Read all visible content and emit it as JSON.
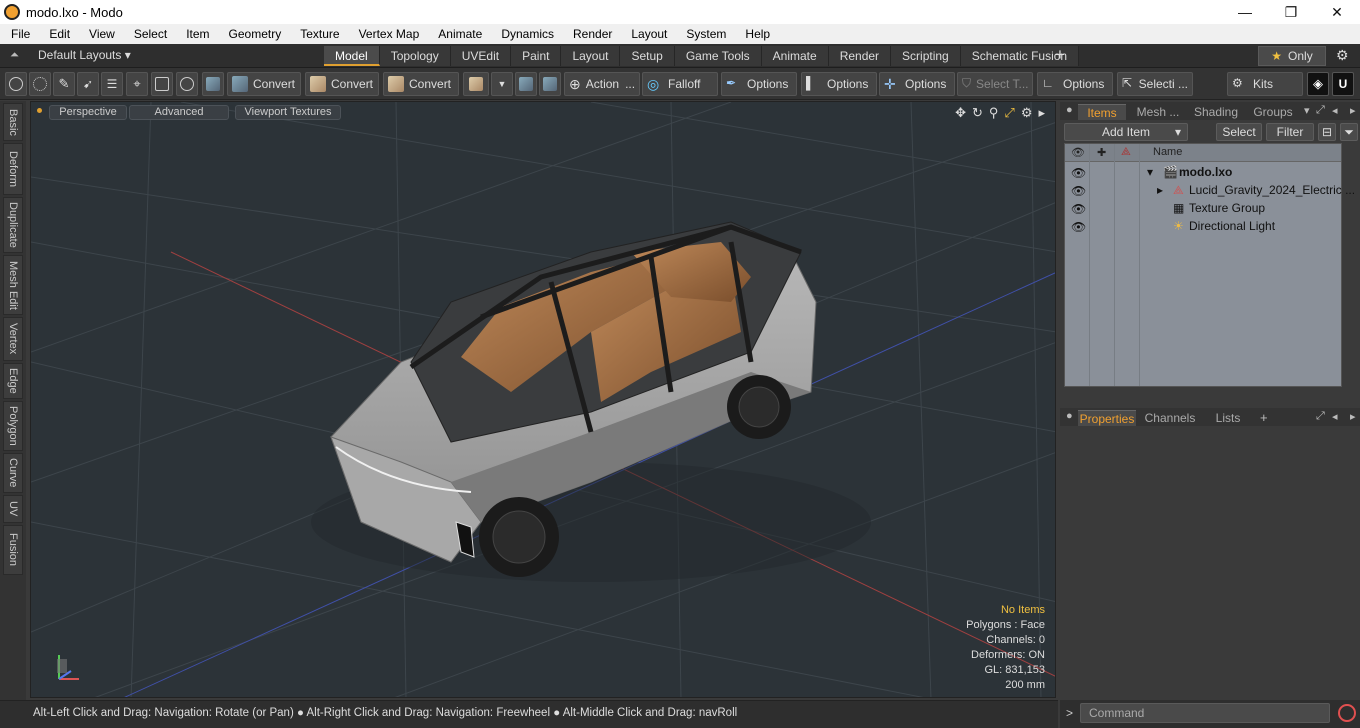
{
  "window": {
    "title": "modo.lxo - Modo",
    "minimize": "—",
    "maximize": "❐",
    "close": "✕"
  },
  "menu": [
    "File",
    "Edit",
    "View",
    "Select",
    "Item",
    "Geometry",
    "Texture",
    "Vertex Map",
    "Animate",
    "Dynamics",
    "Render",
    "Layout",
    "System",
    "Help"
  ],
  "layoutbar": {
    "default_layouts": "Default Layouts ▾",
    "tabs": [
      "Model",
      "Topology",
      "UVEdit",
      "Paint",
      "Layout",
      "Setup",
      "Game Tools",
      "Animate",
      "Render",
      "Scripting",
      "Schematic Fusion"
    ],
    "active_tab": "Model",
    "plus": "+",
    "only": "Only"
  },
  "toolbar": {
    "convert1": "Convert",
    "convert2": "Convert",
    "convert3": "Convert",
    "action": "Action",
    "falloff": "Falloff",
    "options1": "Options",
    "options2": "Options",
    "options3": "Options",
    "select_t": "Select T...",
    "options4": "Options",
    "selecti": "Selecti ...",
    "kits": "Kits"
  },
  "left_tabs": [
    "Basic",
    "Deform",
    "Duplicate",
    "Mesh Edit",
    "Vertex",
    "Edge",
    "Polygon",
    "Curve",
    "UV",
    "Fusion"
  ],
  "viewport": {
    "perspective": "Perspective",
    "advanced": "Advanced",
    "viewport_textures": "Viewport Textures",
    "stats": {
      "no_items": "No Items",
      "polygons": "Polygons : Face",
      "channels": "Channels: 0",
      "deformers": "Deformers: ON",
      "gl": "GL: 831,153",
      "size": "200 mm"
    }
  },
  "statusbar": "Alt-Left Click and Drag: Navigation: Rotate (or Pan) ● Alt-Right Click and Drag: Navigation: Freewheel ● Alt-Middle Click and Drag: navRoll",
  "items_panel": {
    "tabs": [
      "Items",
      "Mesh ...",
      "Shading",
      "Groups"
    ],
    "add_item": "Add Item",
    "select": "Select",
    "filter": "Filter",
    "name_header": "Name",
    "rows": [
      {
        "label": "modo.lxo"
      },
      {
        "label": "Lucid_Gravity_2024_Electric ..."
      },
      {
        "label": "Texture Group"
      },
      {
        "label": "Directional Light"
      }
    ]
  },
  "props_panel": {
    "tabs": [
      "Properties",
      "Channels",
      "Lists"
    ],
    "plus": "+"
  },
  "command": {
    "placeholder": "Command"
  }
}
